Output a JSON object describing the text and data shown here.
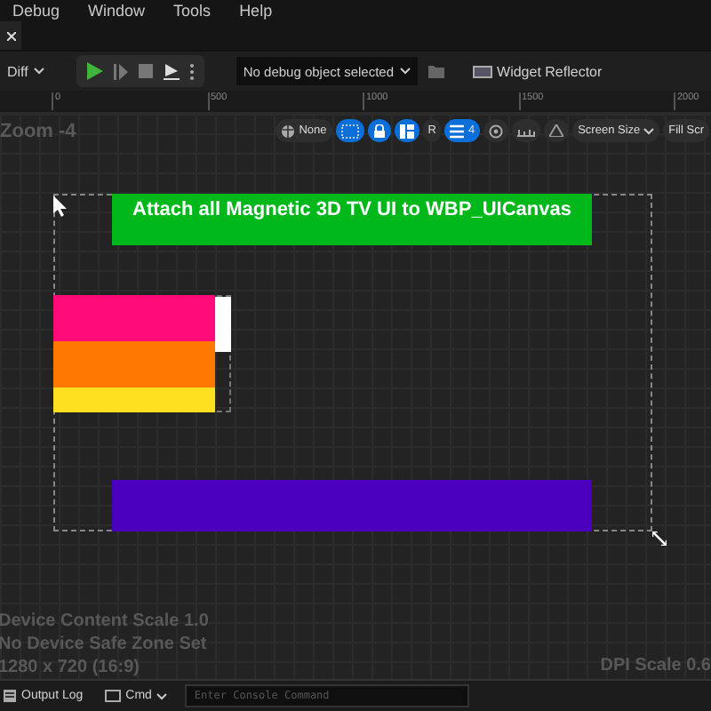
{
  "menu": [
    "Debug",
    "Window",
    "Tools",
    "Help"
  ],
  "toolbar": {
    "diff": "Diff",
    "debug_select": "No debug object selected",
    "reflector": "Widget Reflector"
  },
  "ruler": [
    "0",
    "500",
    "1000",
    "1500",
    "2000"
  ],
  "viewport": {
    "zoom": "Zoom -4",
    "toggles": [
      {
        "kind": "globe",
        "label": "None",
        "on": false
      },
      {
        "kind": "grid",
        "on": true
      },
      {
        "kind": "lock",
        "on": true
      },
      {
        "kind": "layout",
        "on": true
      },
      {
        "kind": "letter",
        "label": "R",
        "on": false
      },
      {
        "kind": "list",
        "label": "4",
        "on": true
      },
      {
        "kind": "target",
        "on": false
      },
      {
        "kind": "ruler",
        "on": false
      },
      {
        "kind": "triangle",
        "on": false
      }
    ],
    "screen_size": "Screen Size",
    "fill": "Fill Scr"
  },
  "canvas": {
    "title": "Attach all Magnetic 3D TV UI to WBP_UICanvas",
    "stack": [
      {
        "color": "#ff0a78"
      },
      {
        "color": "#ff7800"
      },
      {
        "color": "#ffe021"
      }
    ]
  },
  "info": [
    "Device Content Scale 1.0",
    "No Device Safe Zone Set",
    "1280 x 720 (16:9)"
  ],
  "dpi": "DPI Scale 0.6",
  "bottom": {
    "output_log": "Output Log",
    "cmd": "Cmd",
    "placeholder": "Enter Console Command"
  }
}
